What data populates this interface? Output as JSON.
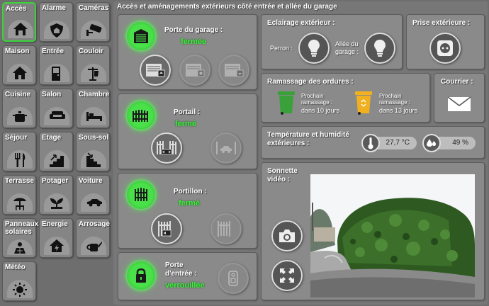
{
  "nav": {
    "items": [
      {
        "label": "Accès",
        "icon": "home-icon",
        "active": true
      },
      {
        "label": "Alarme",
        "icon": "shield-icon"
      },
      {
        "label": "Caméras",
        "icon": "camera-cctv-icon"
      },
      {
        "label": "Maison",
        "icon": "house-icon"
      },
      {
        "label": "Entrée",
        "icon": "door-icon"
      },
      {
        "label": "Couloir",
        "icon": "coat-rack-icon"
      },
      {
        "label": "Cuisine",
        "icon": "pot-icon"
      },
      {
        "label": "Salon",
        "icon": "sofa-icon"
      },
      {
        "label": "Chambre",
        "icon": "bed-icon"
      },
      {
        "label": "Séjour",
        "icon": "cutlery-icon"
      },
      {
        "label": "Etage",
        "icon": "stairs-up-icon"
      },
      {
        "label": "Sous-sol",
        "icon": "stairs-down-icon"
      },
      {
        "label": "Terrasse",
        "icon": "parasol-icon"
      },
      {
        "label": "Potager",
        "icon": "plant-icon"
      },
      {
        "label": "Voiture",
        "icon": "car-icon"
      },
      {
        "label": "Panneaux solaires",
        "icon": "solar-panel-icon"
      },
      {
        "label": "Energie",
        "icon": "energy-house-icon"
      },
      {
        "label": "Arrosage",
        "icon": "watering-can-icon"
      },
      {
        "label": "Météo",
        "icon": "weather-icon"
      }
    ]
  },
  "main": {
    "title": "Accès et aménagements extérieurs côté entrée et allée du garage"
  },
  "garage": {
    "label": "Porte du garage :",
    "status": "fermée"
  },
  "portail": {
    "label": "Portail :",
    "status": "fermé"
  },
  "portillon": {
    "label": "Portillon :",
    "status": "fermé"
  },
  "porte_entree": {
    "label_line1": "Porte",
    "label_line2": "d'entrée :",
    "status": "verrouillée"
  },
  "eclairage": {
    "title": "Eclairage extérieur :",
    "perron": "Perron :",
    "allee_line1": "Allée du",
    "allee_line2": "garage :"
  },
  "prise": {
    "title": "Prise extérieure :"
  },
  "ramassage": {
    "title": "Ramassage des ordures :",
    "bin1": {
      "line1": "Prochain",
      "line2": "ramassage :",
      "when": "dans 10 jours",
      "color": "#3aa03a"
    },
    "bin2": {
      "line1": "Prochain",
      "line2": "ramassage :",
      "when": "dans 13 jours",
      "color": "#f0b020"
    }
  },
  "courrier": {
    "title": "Courrier :"
  },
  "temperature": {
    "title_line1": "Température et humidité",
    "title_line2": "extérieures :",
    "temp": "27,7 °C",
    "humidity": "49 %"
  },
  "sonnette": {
    "title_line1": "Sonnette",
    "title_line2": "vidéo :"
  },
  "colors": {
    "active_green": "#3cf03c",
    "active_border": "#3ad43a"
  }
}
